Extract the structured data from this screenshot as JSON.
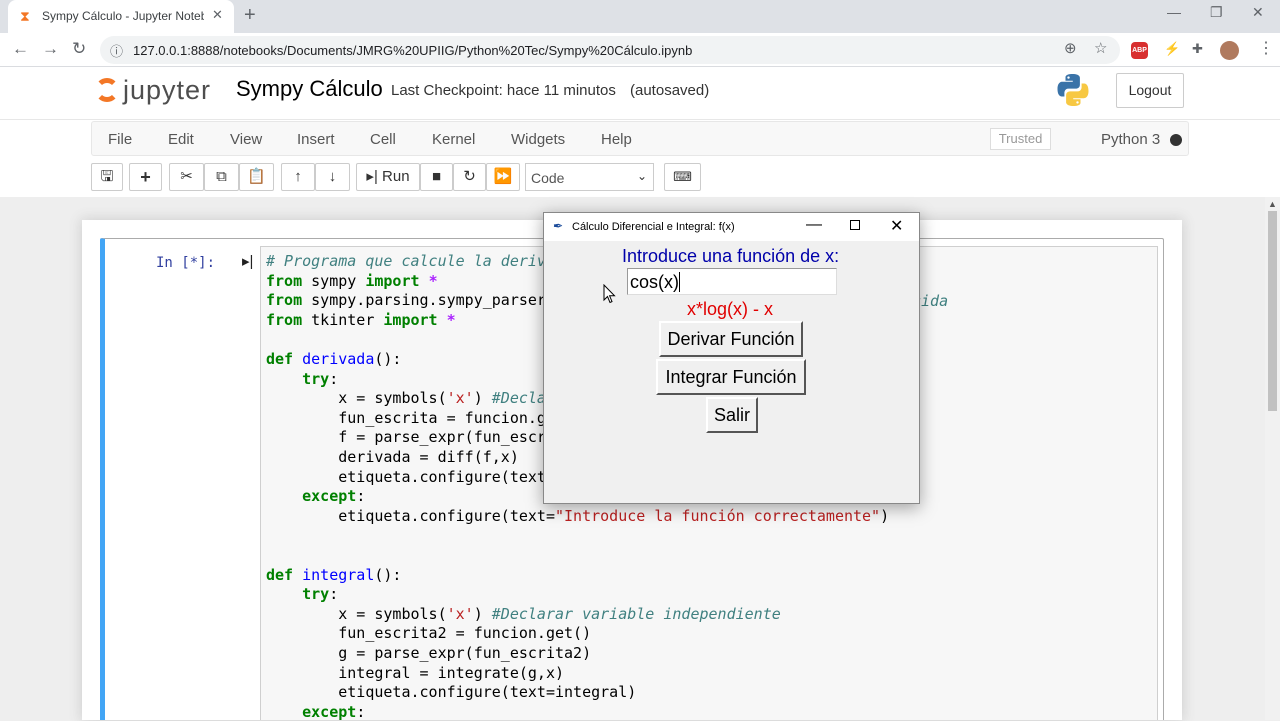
{
  "browser": {
    "tab_title": "Sympy Cálculo - Jupyter Noteboo",
    "tab_close": "✕",
    "new_tab": "+",
    "url": "127.0.0.1:8888/notebooks/Documents/JMRG%20UPIIG/Python%20Tec/Sympy%20Cálculo.ipynb",
    "icons": [
      "back-icon",
      "forward-icon",
      "reload-icon",
      "info-icon",
      "zoom-icon",
      "star-icon",
      "adblock-icon",
      "extension-icon",
      "puzzle-icon",
      "profile-icon",
      "menu-icon"
    ],
    "abp_label": "ABP"
  },
  "jupyter": {
    "logo_text": "jupyter",
    "notebook_name": "Sympy Cálculo",
    "checkpoint": "Last Checkpoint: hace 11 minutos",
    "autosave": "(autosaved)",
    "logout": "Logout",
    "menu": [
      "File",
      "Edit",
      "View",
      "Insert",
      "Cell",
      "Kernel",
      "Widgets",
      "Help"
    ],
    "trusted": "Trusted",
    "kernel": "Python 3",
    "run_label": "Run",
    "cell_type": "Code"
  },
  "cell": {
    "prompt": "In [*]:",
    "lines": [
      "# Programa que calcule la deriv",
      "from sympy import *",
      "from sympy.parsing.sympy_parser",
      "from tkinter import *",
      "",
      "def derivada():",
      "    try:",
      "        x = symbols('x') #Decla",
      "        fun_escrita = funcion.g",
      "        f = parse_expr(fun_escr",
      "        derivada = diff(f,x)",
      "        etiqueta.configure(text",
      "    except:",
      "        etiqueta.configure(text=\"Introduce la función correctamente\")",
      "",
      "",
      "def integral():",
      "    try:",
      "        x = symbols('x') #Declarar variable independiente",
      "        fun_escrita2 = funcion.get()",
      "        g = parse_expr(fun_escrita2)",
      "        integral = integrate(g,x)",
      "        etiqueta.configure(text=integral)",
      "    except:"
    ],
    "trailing_fragment": "cida"
  },
  "tk_window": {
    "title": "Cálculo Diferencial e Integral: f(x)",
    "prompt": "Introduce una función de x:",
    "entry_value": "cos(x)",
    "result": "x*log(x) - x",
    "derive_button": "Derivar Función",
    "integrate_button": "Integrar Función",
    "exit_button": "Salir"
  }
}
